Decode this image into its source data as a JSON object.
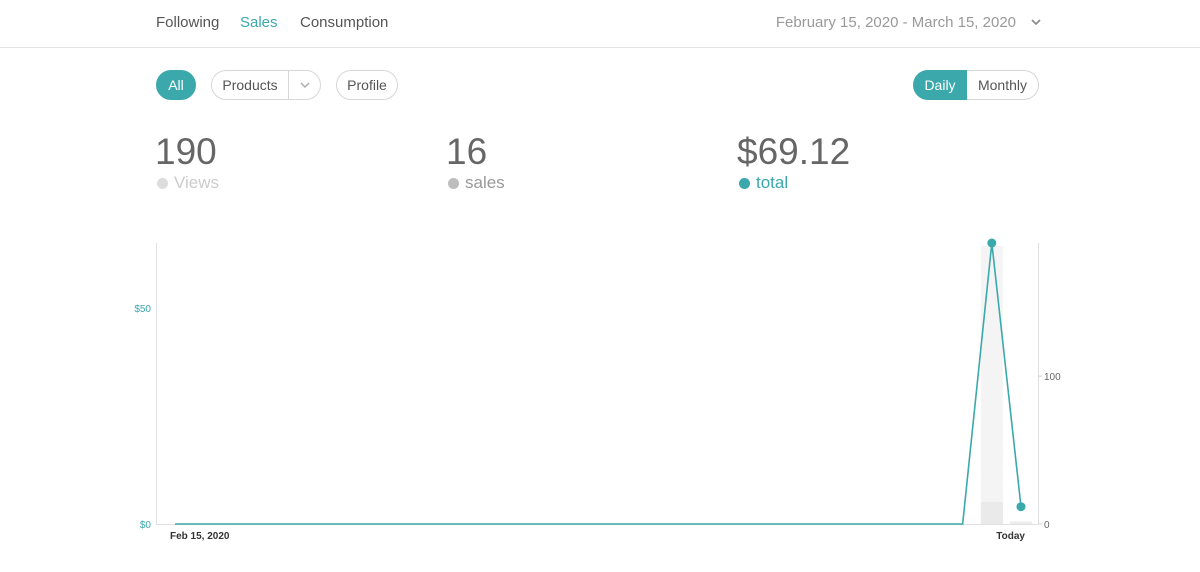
{
  "nav": {
    "tabs": [
      {
        "label": "Following",
        "active": false
      },
      {
        "label": "Sales",
        "active": true
      },
      {
        "label": "Consumption",
        "active": false
      }
    ],
    "date_range": "February 15, 2020 - March 15, 2020"
  },
  "filters": {
    "all_label": "All",
    "products_label": "Products",
    "profile_label": "Profile"
  },
  "granularity": {
    "daily_label": "Daily",
    "monthly_label": "Monthly",
    "selected": "Daily"
  },
  "stats": [
    {
      "value": "190",
      "label": "Views",
      "color": "#dddddd"
    },
    {
      "value": "16",
      "label": "sales",
      "color": "#bdbdbd"
    },
    {
      "value": "$69.12",
      "label": "total",
      "color": "#3ba8ac"
    }
  ],
  "colors": {
    "accent": "#3ba8ac",
    "text": "#555555",
    "muted": "#999999",
    "border": "#d7d7d7"
  },
  "chart_data": {
    "type": "line",
    "x_start_label": "Feb 15, 2020",
    "x_end_label": "Today",
    "x_categories_count": 30,
    "left_axis": {
      "ticks": [
        "$50",
        "$0"
      ],
      "tick_values": [
        50,
        0
      ],
      "ylim": [
        0,
        65
      ]
    },
    "right_axis": {
      "ticks": [
        "100",
        "0"
      ],
      "tick_values": [
        100,
        0
      ],
      "ylim": [
        0,
        190
      ]
    },
    "series": [
      {
        "name": "total",
        "values": [
          0,
          0,
          0,
          0,
          0,
          0,
          0,
          0,
          0,
          0,
          0,
          0,
          0,
          0,
          0,
          0,
          0,
          0,
          0,
          0,
          0,
          0,
          0,
          0,
          0,
          0,
          0,
          0,
          65,
          4
        ]
      },
      {
        "name": "sales",
        "values": [
          0,
          0,
          0,
          0,
          0,
          0,
          0,
          0,
          0,
          0,
          0,
          0,
          0,
          0,
          0,
          0,
          0,
          0,
          0,
          0,
          0,
          0,
          0,
          0,
          0,
          0,
          0,
          0,
          15,
          1
        ]
      },
      {
        "name": "Views",
        "values": [
          0,
          0,
          0,
          0,
          0,
          0,
          0,
          0,
          0,
          0,
          0,
          0,
          0,
          0,
          0,
          0,
          0,
          0,
          0,
          0,
          0,
          0,
          0,
          0,
          0,
          0,
          0,
          0,
          188,
          2
        ]
      }
    ],
    "grid": false
  }
}
